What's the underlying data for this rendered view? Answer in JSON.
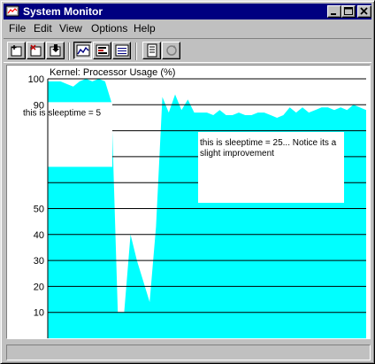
{
  "window": {
    "title": "System Monitor",
    "controls": [
      "_",
      "□",
      "×"
    ]
  },
  "menu": [
    "File",
    "Edit",
    "View",
    "Options",
    "Help"
  ],
  "toolbar": {
    "icons": [
      "add-counter-icon",
      "delete-counter-icon",
      "edit-counter-icon",
      "chart-view-icon",
      "histogram-view-icon",
      "report-view-icon",
      "bookmark-icon",
      "update-icon"
    ],
    "pressed": "chart-view-icon"
  },
  "chart_data": {
    "type": "area",
    "title": "Kernel: Processor Usage (%)",
    "ylim": [
      0,
      100
    ],
    "y_ticks": [
      10,
      20,
      30,
      40,
      50,
      90,
      100
    ],
    "fill_color": "#00ffff",
    "grid": true,
    "x": [
      0,
      2,
      4,
      6,
      8,
      10,
      12,
      14,
      16,
      18,
      20,
      22,
      24,
      26,
      28,
      30,
      32,
      34,
      36,
      38,
      40,
      42,
      44,
      46,
      48,
      50,
      52,
      54,
      56,
      58,
      60,
      62,
      64,
      66,
      68,
      70,
      72,
      74,
      76,
      78,
      80,
      82,
      84,
      86,
      88,
      90,
      92,
      94,
      96,
      98,
      100
    ],
    "values": [
      99,
      99,
      99,
      98,
      97,
      99,
      100,
      99,
      100,
      99,
      91,
      10,
      10,
      40,
      30,
      22,
      14,
      43,
      93,
      87,
      94,
      88,
      92,
      87,
      87,
      87,
      86,
      88,
      86,
      86,
      87,
      86,
      86,
      87,
      87,
      86,
      85,
      86,
      89,
      87,
      89,
      87,
      88,
      89,
      89,
      88,
      89,
      88,
      90,
      89,
      88
    ],
    "annotations": [
      {
        "text": "this is sleeptime = 5"
      },
      {
        "text": "this is sleeptime = 25... Notice its a slight improvement"
      }
    ]
  }
}
